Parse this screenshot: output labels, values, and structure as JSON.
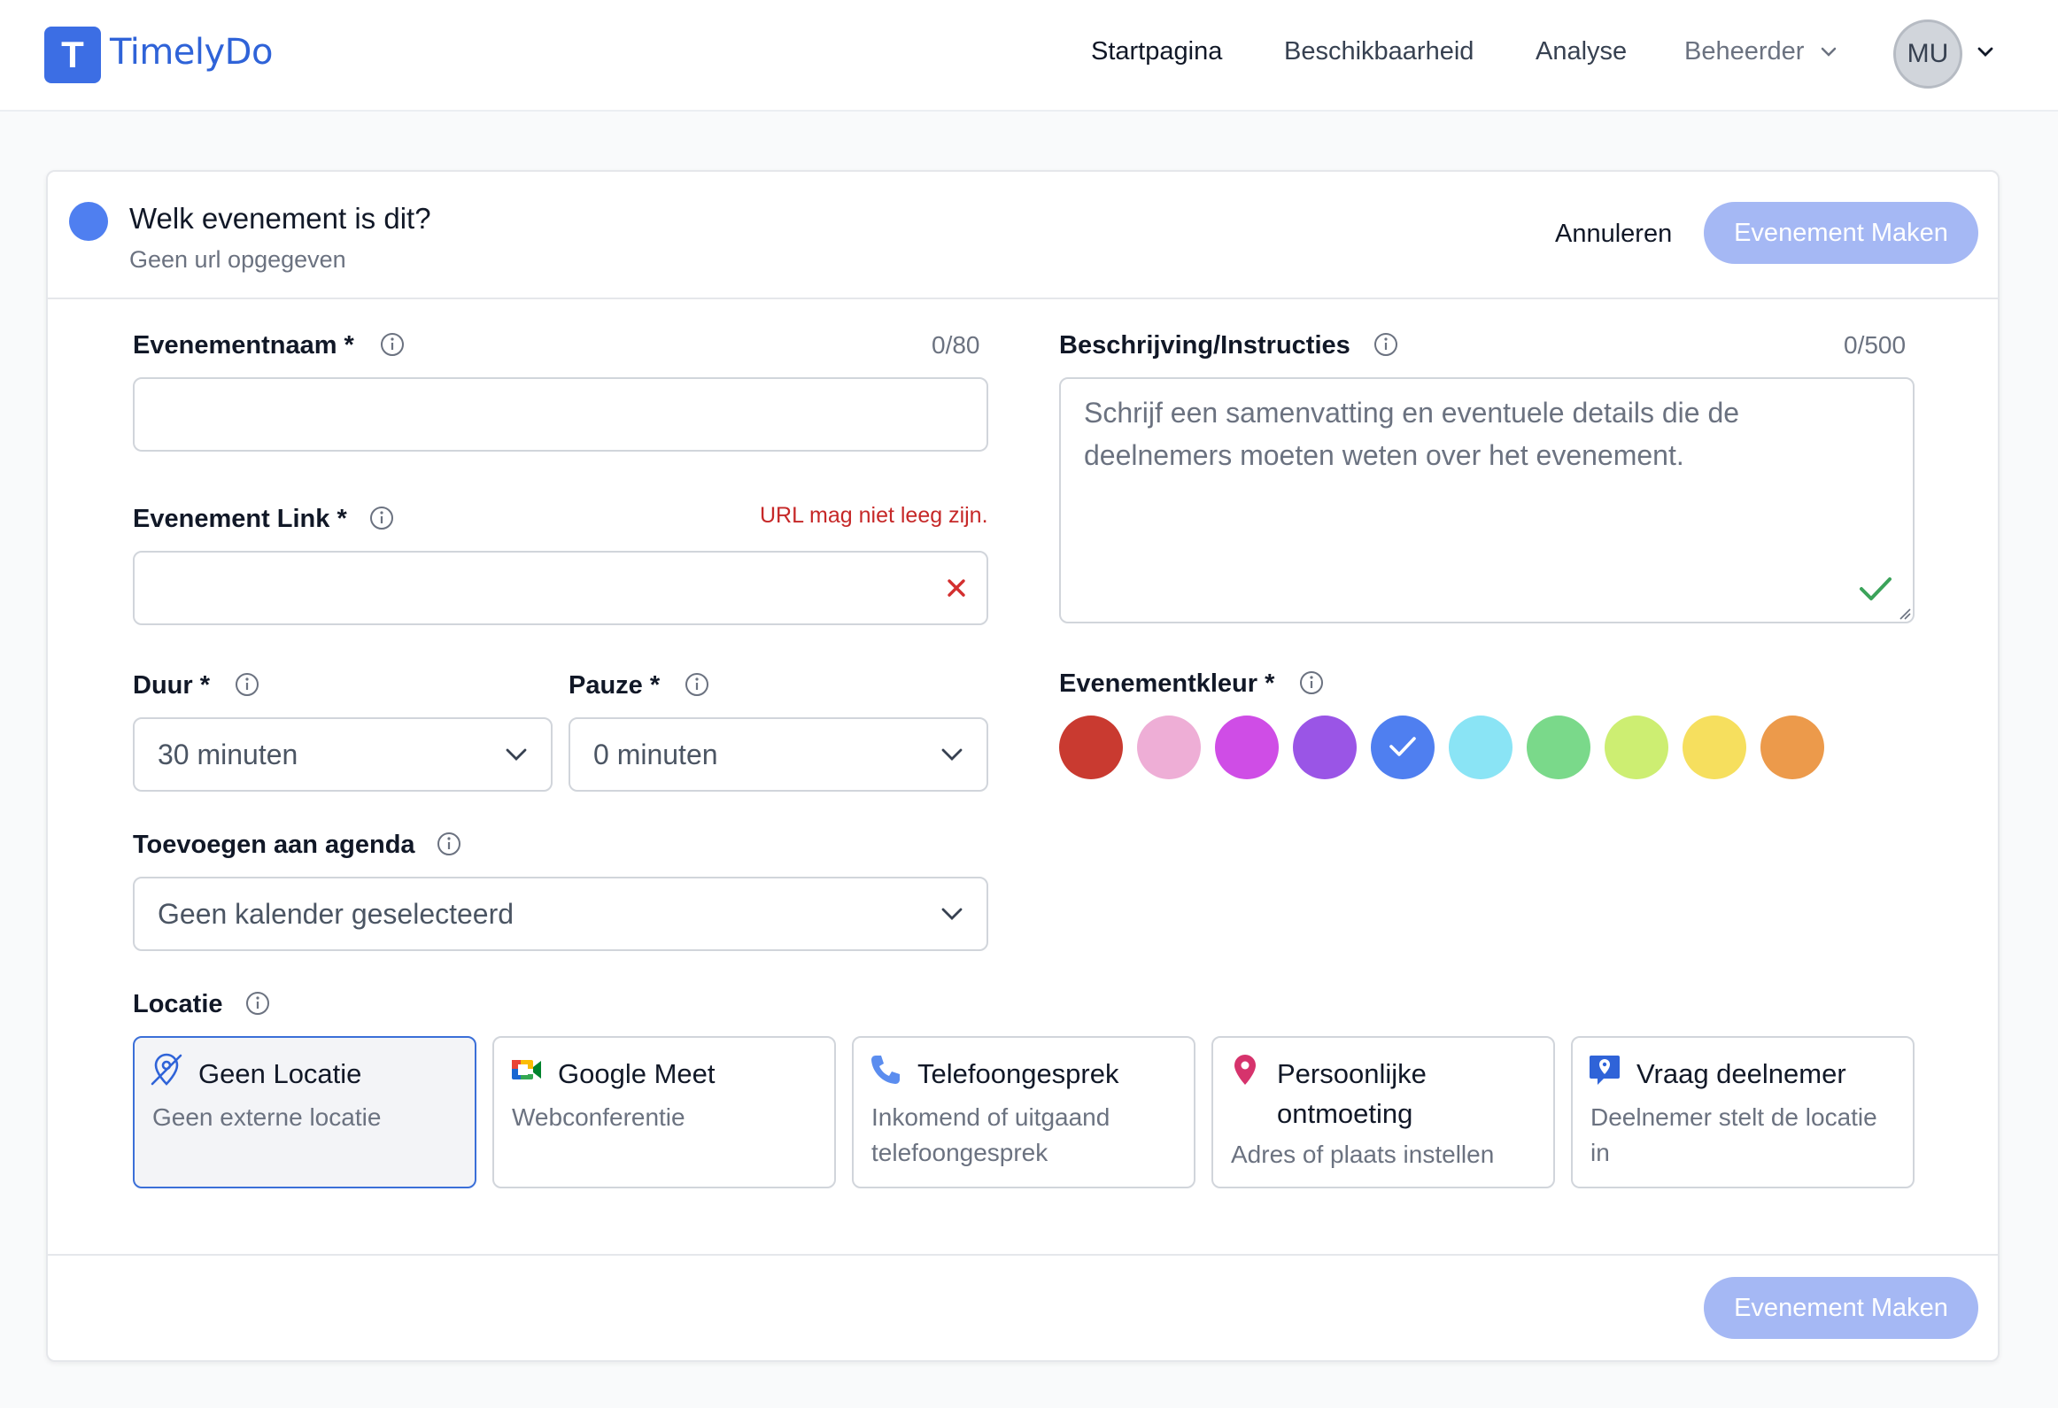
{
  "app": {
    "logo_letter": "T",
    "name": "TimelyDo"
  },
  "nav": {
    "items": [
      "Startpagina",
      "Beschikbaarheid",
      "Analyse"
    ],
    "admin": "Beheerder",
    "avatar": "MU"
  },
  "event": {
    "title": "Welk evenement is dit?",
    "url_status": "Geen url opgegeven",
    "cancel": "Annuleren",
    "create": "Evenement Maken"
  },
  "form": {
    "name": {
      "label": "Evenementnaam *",
      "counter": "0/80",
      "value": ""
    },
    "link": {
      "label": "Evenement Link *",
      "error": "URL mag niet leeg zijn.",
      "value": ""
    },
    "duration": {
      "label": "Duur *",
      "value": "30 minuten"
    },
    "pause": {
      "label": "Pauze *",
      "value": "0 minuten"
    },
    "calendar": {
      "label": "Toevoegen aan agenda",
      "value": "Geen kalender geselecteerd"
    },
    "description": {
      "label": "Beschrijving/Instructies",
      "counter": "0/500",
      "placeholder": "Schrijf een samenvatting en eventuele details die de deelnemers moeten weten over het evenement."
    },
    "color": {
      "label": "Evenementkleur *",
      "swatches": [
        "#c93a30",
        "#eeaed6",
        "#cf4de6",
        "#9a55e6",
        "#4f7ff0",
        "#8ae4f5",
        "#7ad98a",
        "#cdee72",
        "#f6df5e",
        "#ec9a4b"
      ],
      "selected": "#4f7ff0"
    },
    "location": {
      "label": "Locatie",
      "options": [
        {
          "title": "Geen Locatie",
          "sub": "Geen externe locatie",
          "icon": "no-location-icon"
        },
        {
          "title": "Google Meet",
          "sub": "Webconferentie",
          "icon": "google-meet-icon"
        },
        {
          "title": "Telefoongesprek",
          "sub": "Inkomend of uitgaand telefoongesprek",
          "icon": "phone-icon"
        },
        {
          "title": "Persoonlijke ontmoeting",
          "sub": "Adres of plaats instellen",
          "icon": "map-pin-icon"
        },
        {
          "title": "Vraag deelnemer",
          "sub": "Deelnemer stelt de locatie in",
          "icon": "ask-location-icon"
        }
      ],
      "selected_index": 0
    }
  }
}
